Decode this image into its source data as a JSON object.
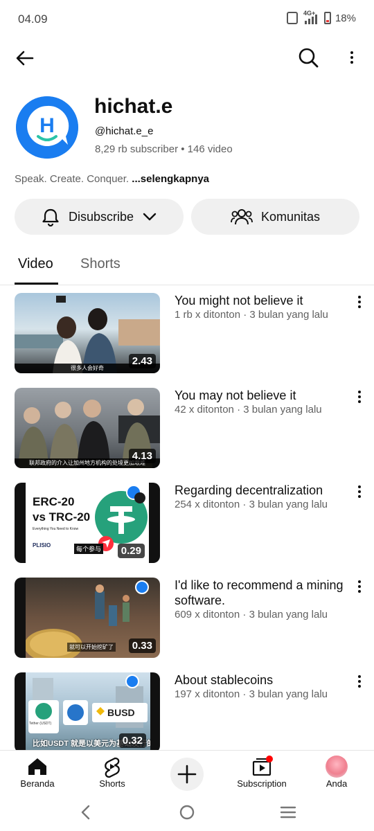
{
  "status_bar": {
    "time": "04.09",
    "network": "4G+",
    "battery": "18%"
  },
  "top_bar": {
    "back_icon": "arrow-left-icon",
    "search_icon": "search-icon",
    "more_icon": "more-vertical-icon"
  },
  "channel": {
    "name": "hichat.e",
    "handle": "@hichat.e_e",
    "stats": "8,29 rb subscriber • 146 video",
    "description": "Speak. Create. Conquer.",
    "more_link": "...selengkapnya",
    "avatar_letter": "H",
    "brand_color": "#1a7df0"
  },
  "actions": {
    "subscribe_label": "Disubscribe",
    "community_label": "Komunitas"
  },
  "tabs": [
    {
      "label": "Video",
      "active": true
    },
    {
      "label": "Shorts",
      "active": false
    }
  ],
  "videos": [
    {
      "title": "You might not believe it",
      "meta": "1 rb x ditonton · 3 bulan yang lalu",
      "duration": "2.43",
      "caption": "很多人会好奇"
    },
    {
      "title": "You may not believe it",
      "meta": "42 x ditonton · 3 bulan yang lalu",
      "duration": "4.13",
      "caption": "联邦政府的介入让加州地方机构的处境更加艰难"
    },
    {
      "title": "Regarding decentralization",
      "meta": "254 x ditonton · 3 bulan yang lalu",
      "duration": "0.29",
      "thumb_line1": "ERC-20",
      "thumb_line2": "vs TRC-20",
      "thumb_line3": "Everything You Need to Know",
      "thumb_brand": "PLISIO",
      "caption": "每个参与"
    },
    {
      "title": "I'd like to recommend a mining software.",
      "meta": "609 x ditonton · 3 bulan yang lalu",
      "duration": "0.33",
      "caption": "就可以开始挖矿了"
    },
    {
      "title": "About stablecoins",
      "meta": "197 x ditonton · 3 bulan yang lalu",
      "duration": "0.32",
      "thumb_badge": "BUSD",
      "thumb_tether": "Tether (USDT)",
      "caption": "比如USDT 就是以美元为基础发行的"
    }
  ],
  "bottom_nav": [
    {
      "label": "Beranda",
      "icon": "home-icon"
    },
    {
      "label": "Shorts",
      "icon": "shorts-icon"
    },
    {
      "label": "",
      "icon": "plus-icon"
    },
    {
      "label": "Subscription",
      "icon": "subscriptions-icon"
    },
    {
      "label": "Anda",
      "icon": "profile-avatar-icon"
    }
  ]
}
